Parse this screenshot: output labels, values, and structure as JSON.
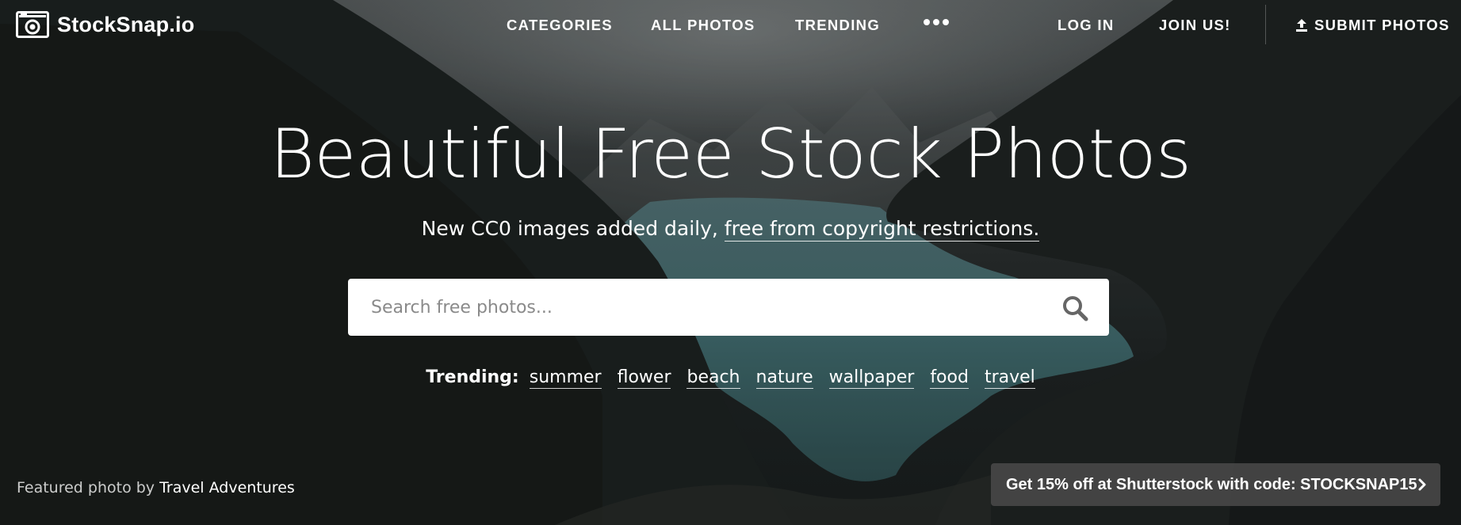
{
  "brand": {
    "name": "StockSnap.io",
    "icon": "camera-icon"
  },
  "nav": {
    "categories": "CATEGORIES",
    "all_photos": "ALL PHOTOS",
    "trending": "TRENDING",
    "more_icon": "more-dots-icon",
    "log_in": "LOG IN",
    "join": "JOIN US!",
    "submit": "SUBMIT PHOTOS",
    "submit_icon": "upload-icon"
  },
  "hero": {
    "headline": "Beautiful Free Stock Photos",
    "subline_prefix": "New CC0 images added daily, ",
    "subline_link": "free from copyright restrictions."
  },
  "search": {
    "placeholder": "Search free photos...",
    "value": "",
    "icon": "search-icon"
  },
  "trending": {
    "label": "Trending:",
    "tags": [
      "summer",
      "flower",
      "beach",
      "nature",
      "wallpaper",
      "food",
      "travel"
    ]
  },
  "footer": {
    "featured_prefix": "Featured photo by ",
    "featured_author": "Travel Adventures",
    "promo_text": "Get 15% off at Shutterstock with code: STOCKSNAP15",
    "promo_icon": "chevron-right-icon"
  },
  "colors": {
    "lake": "#3e6a6d",
    "mountain_dark": "#1a1f1e",
    "sky": "#5c6162",
    "promo_bg": "#464646"
  }
}
